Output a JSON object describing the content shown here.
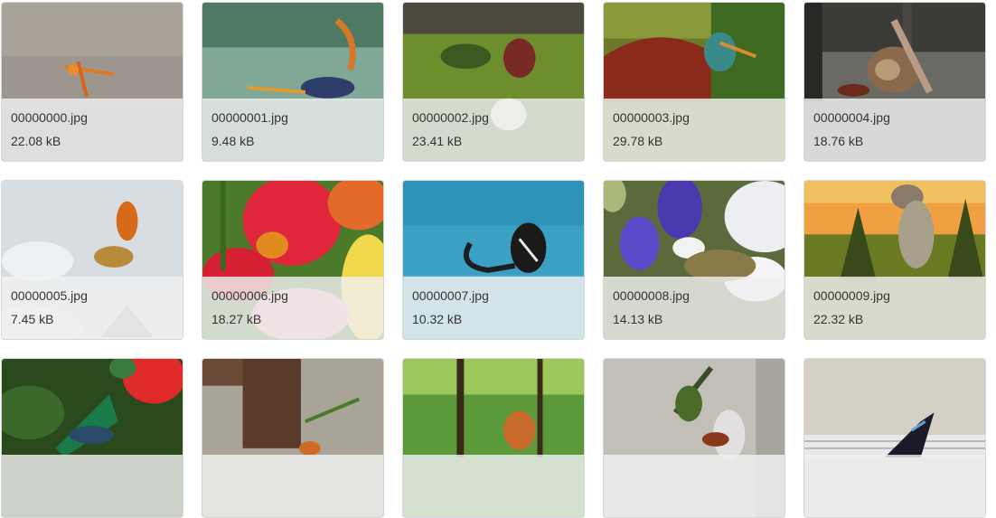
{
  "gallery": {
    "items": [
      {
        "name": "00000000.jpg",
        "size": "22.08 kB",
        "thumb": "insect-on-sand"
      },
      {
        "name": "00000001.jpg",
        "size": "9.48 kB",
        "thumb": "scorpion-by-water"
      },
      {
        "name": "00000002.jpg",
        "size": "23.41 kB",
        "thumb": "insect-on-moss"
      },
      {
        "name": "00000003.jpg",
        "size": "29.78 kB",
        "thumb": "insect-in-red-foliage"
      },
      {
        "name": "00000004.jpg",
        "size": "18.76 kB",
        "thumb": "snail-on-wall"
      },
      {
        "name": "00000005.jpg",
        "size": "7.45 kB",
        "thumb": "butterflies-in-sky"
      },
      {
        "name": "00000006.jpg",
        "size": "18.27 kB",
        "thumb": "butterfly-on-tulips"
      },
      {
        "name": "00000007.jpg",
        "size": "10.32 kB",
        "thumb": "scorpion-and-butterfly"
      },
      {
        "name": "00000008.jpg",
        "size": "14.13 kB",
        "thumb": "butterfly-on-flowers"
      },
      {
        "name": "00000009.jpg",
        "size": "22.32 kB",
        "thumb": "snail-at-sunset"
      },
      {
        "name": "",
        "size": "",
        "thumb": "beetle-on-red-flower"
      },
      {
        "name": "",
        "size": "",
        "thumb": "mantis-by-table-leg"
      },
      {
        "name": "",
        "size": "",
        "thumb": "insect-in-forest"
      },
      {
        "name": "",
        "size": "",
        "thumb": "grasshopper-on-wall"
      },
      {
        "name": "",
        "size": "",
        "thumb": "butterfly-on-wall"
      }
    ]
  }
}
